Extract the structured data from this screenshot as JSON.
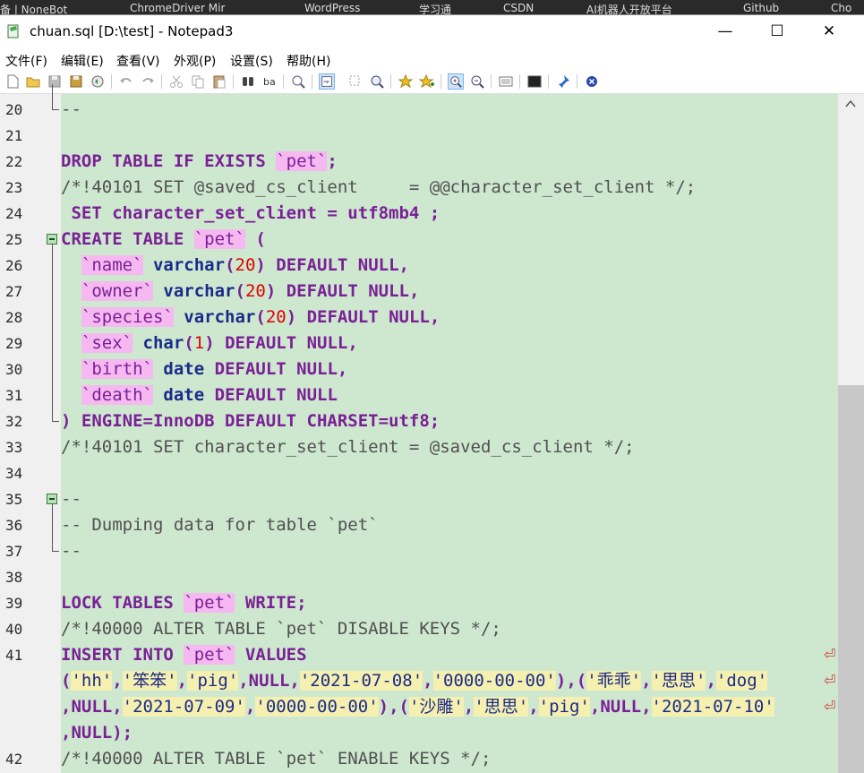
{
  "bg_tabs": [
    "备 | NoneBot",
    "ChromeDriver Mir",
    "WordPress",
    "学习通",
    "CSDN",
    "AI机器人开放平台",
    "Github",
    "Cho"
  ],
  "window": {
    "title": "chuan.sql [D:\\test] - Notepad3",
    "min_glyph": "—",
    "max_glyph": "☐",
    "close_glyph": "✕"
  },
  "menu": [
    "文件(F)",
    "编辑(E)",
    "查看(V)",
    "外观(P)",
    "设置(S)",
    "帮助(H)"
  ],
  "toolbar_icons": [
    "new-file-icon",
    "open-folder-icon",
    "save-icon",
    "save-as-icon",
    "revert-icon",
    "undo-icon",
    "redo-icon",
    "cut-icon",
    "copy-icon",
    "paste-icon",
    "find-icon",
    "replace-icon",
    "goto-icon",
    "word-wrap-icon",
    "select-icon",
    "zoom-icon",
    "favorite-icon",
    "add-favorite-icon",
    "zoom-in-icon",
    "zoom-out-icon",
    "schemes-icon",
    "console-icon",
    "pin-icon",
    "close-doc-icon"
  ],
  "colors": {
    "editor_bg": "#cde8cf",
    "keyword": "#7b1f96",
    "type": "#1a2a8a",
    "identifier_bg": "#f5b8f0",
    "string_bg": "#f5f0b0",
    "number": "#e00000"
  },
  "editor": {
    "lines": [
      {
        "ln": "20",
        "tokens": [
          {
            "t": "--",
            "c": "cm"
          }
        ]
      },
      {
        "ln": "21",
        "tokens": []
      },
      {
        "ln": "22",
        "tokens": [
          {
            "t": "DROP TABLE IF EXISTS ",
            "c": "kw"
          },
          {
            "t": "`pet`",
            "c": "bt"
          },
          {
            "t": ";",
            "c": "kw"
          }
        ]
      },
      {
        "ln": "23",
        "tokens": [
          {
            "t": "/*!40101 SET @saved_cs_client     = @@character_set_client */;",
            "c": "cm"
          }
        ]
      },
      {
        "ln": "24",
        "tokens": [
          {
            "t": " SET character_set_client = utf8mb4 ;",
            "c": "kw"
          }
        ]
      },
      {
        "ln": "25",
        "tokens": [
          {
            "t": "CREATE TABLE ",
            "c": "kw"
          },
          {
            "t": "`pet`",
            "c": "bt"
          },
          {
            "t": " (",
            "c": "kw"
          }
        ]
      },
      {
        "ln": "26",
        "tokens": [
          {
            "t": "  ",
            "c": "pl"
          },
          {
            "t": "`name`",
            "c": "bt"
          },
          {
            "t": " ",
            "c": "pl"
          },
          {
            "t": "varchar",
            "c": "ty"
          },
          {
            "t": "(",
            "c": "kw"
          },
          {
            "t": "20",
            "c": "num"
          },
          {
            "t": ") DEFAULT NULL,",
            "c": "kw"
          }
        ]
      },
      {
        "ln": "27",
        "tokens": [
          {
            "t": "  ",
            "c": "pl"
          },
          {
            "t": "`owner`",
            "c": "bt"
          },
          {
            "t": " ",
            "c": "pl"
          },
          {
            "t": "varchar",
            "c": "ty"
          },
          {
            "t": "(",
            "c": "kw"
          },
          {
            "t": "20",
            "c": "num"
          },
          {
            "t": ") DEFAULT NULL,",
            "c": "kw"
          }
        ]
      },
      {
        "ln": "28",
        "tokens": [
          {
            "t": "  ",
            "c": "pl"
          },
          {
            "t": "`species`",
            "c": "bt"
          },
          {
            "t": " ",
            "c": "pl"
          },
          {
            "t": "varchar",
            "c": "ty"
          },
          {
            "t": "(",
            "c": "kw"
          },
          {
            "t": "20",
            "c": "num"
          },
          {
            "t": ") DEFAULT NULL,",
            "c": "kw"
          }
        ]
      },
      {
        "ln": "29",
        "tokens": [
          {
            "t": "  ",
            "c": "pl"
          },
          {
            "t": "`sex`",
            "c": "bt"
          },
          {
            "t": " ",
            "c": "pl"
          },
          {
            "t": "char",
            "c": "ty"
          },
          {
            "t": "(",
            "c": "kw"
          },
          {
            "t": "1",
            "c": "num"
          },
          {
            "t": ") DEFAULT NULL,",
            "c": "kw"
          }
        ]
      },
      {
        "ln": "30",
        "tokens": [
          {
            "t": "  ",
            "c": "pl"
          },
          {
            "t": "`birth`",
            "c": "bt"
          },
          {
            "t": " ",
            "c": "pl"
          },
          {
            "t": "date",
            "c": "ty"
          },
          {
            "t": " DEFAULT NULL,",
            "c": "kw"
          }
        ]
      },
      {
        "ln": "31",
        "tokens": [
          {
            "t": "  ",
            "c": "pl"
          },
          {
            "t": "`death`",
            "c": "bt"
          },
          {
            "t": " ",
            "c": "pl"
          },
          {
            "t": "date",
            "c": "ty"
          },
          {
            "t": " DEFAULT NULL",
            "c": "kw"
          }
        ]
      },
      {
        "ln": "32",
        "tokens": [
          {
            "t": ") ENGINE=InnoDB DEFAULT CHARSET=utf8;",
            "c": "kw"
          }
        ]
      },
      {
        "ln": "33",
        "tokens": [
          {
            "t": "/*!40101 SET character_set_client = @saved_cs_client */;",
            "c": "cm"
          }
        ]
      },
      {
        "ln": "34",
        "tokens": []
      },
      {
        "ln": "35",
        "tokens": [
          {
            "t": "--",
            "c": "cm"
          }
        ]
      },
      {
        "ln": "36",
        "tokens": [
          {
            "t": "-- Dumping data for table `pet`",
            "c": "cm"
          }
        ]
      },
      {
        "ln": "37",
        "tokens": [
          {
            "t": "--",
            "c": "cm"
          }
        ]
      },
      {
        "ln": "38",
        "tokens": []
      },
      {
        "ln": "39",
        "tokens": [
          {
            "t": "LOCK TABLES ",
            "c": "kw"
          },
          {
            "t": "`pet`",
            "c": "bt"
          },
          {
            "t": " WRITE;",
            "c": "kw"
          }
        ]
      },
      {
        "ln": "40",
        "tokens": [
          {
            "t": "/*!40000 ALTER TABLE `pet` DISABLE KEYS */;",
            "c": "cm"
          }
        ]
      },
      {
        "ln": "41",
        "tokens": [
          {
            "t": "INSERT INTO ",
            "c": "kw"
          },
          {
            "t": "`pet`",
            "c": "bt"
          },
          {
            "t": " VALUES",
            "c": "kw"
          }
        ],
        "wrapmark": "⏎"
      },
      {
        "ln": "",
        "tokens": [
          {
            "t": "(",
            "c": "kw"
          },
          {
            "t": "'hh'",
            "c": "str"
          },
          {
            "t": ",",
            "c": "kw"
          },
          {
            "t": "'笨笨'",
            "c": "str"
          },
          {
            "t": ",",
            "c": "kw"
          },
          {
            "t": "'pig'",
            "c": "str"
          },
          {
            "t": ",NULL,",
            "c": "kw"
          },
          {
            "t": "'2021-07-08'",
            "c": "str"
          },
          {
            "t": ",",
            "c": "kw"
          },
          {
            "t": "'0000-00-00'",
            "c": "str"
          },
          {
            "t": "),(",
            "c": "kw"
          },
          {
            "t": "'乖乖'",
            "c": "str"
          },
          {
            "t": ",",
            "c": "kw"
          },
          {
            "t": "'思思'",
            "c": "str"
          },
          {
            "t": ",",
            "c": "kw"
          },
          {
            "t": "'dog'",
            "c": "str"
          }
        ],
        "wrapmark": "⏎"
      },
      {
        "ln": "",
        "tokens": [
          {
            "t": ",NULL,",
            "c": "kw"
          },
          {
            "t": "'2021-07-09'",
            "c": "str"
          },
          {
            "t": ",",
            "c": "kw"
          },
          {
            "t": "'0000-00-00'",
            "c": "str"
          },
          {
            "t": "),(",
            "c": "kw"
          },
          {
            "t": "'沙雕'",
            "c": "str"
          },
          {
            "t": ",",
            "c": "kw"
          },
          {
            "t": "'思思'",
            "c": "str"
          },
          {
            "t": ",",
            "c": "kw"
          },
          {
            "t": "'pig'",
            "c": "str"
          },
          {
            "t": ",NULL,",
            "c": "kw"
          },
          {
            "t": "'2021-07-10'",
            "c": "str"
          }
        ],
        "wrapmark": "⏎"
      },
      {
        "ln": "",
        "tokens": [
          {
            "t": ",NULL);",
            "c": "kw"
          }
        ]
      },
      {
        "ln": "42",
        "tokens": [
          {
            "t": "/*!40000 ALTER TABLE `pet` ENABLE KEYS */;",
            "c": "cm"
          }
        ]
      }
    ]
  }
}
